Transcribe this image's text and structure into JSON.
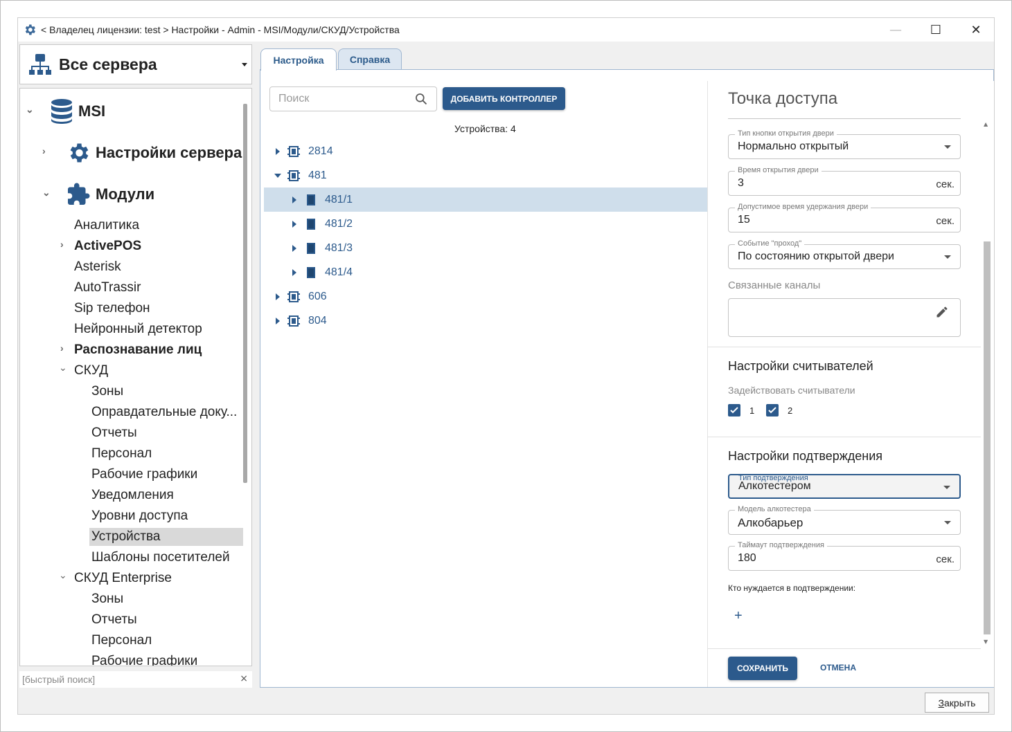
{
  "window": {
    "title": "< Владелец лицензии: test > Настройки - Admin - MSI/Модули/СКУД/Устройства",
    "min_symbol": "—",
    "max_symbol": "☐",
    "close_symbol": "✕"
  },
  "server_select": {
    "label": "Все сервера"
  },
  "tree": {
    "root": "MSI",
    "server_settings": "Настройки сервера",
    "modules": "Модули",
    "items": [
      {
        "label": "Аналитика"
      },
      {
        "label": "ActivePOS"
      },
      {
        "label": "Asterisk"
      },
      {
        "label": "AutoTrassir"
      },
      {
        "label": "Sip телефон"
      },
      {
        "label": "Нейронный детектор"
      },
      {
        "label": "Распознавание лиц"
      },
      {
        "label": "СКУД"
      },
      {
        "label": "Зоны"
      },
      {
        "label": "Оправдательные доку..."
      },
      {
        "label": "Отчеты"
      },
      {
        "label": "Персонал"
      },
      {
        "label": "Рабочие графики"
      },
      {
        "label": "Уведомления"
      },
      {
        "label": "Уровни доступа"
      },
      {
        "label": "Устройства"
      },
      {
        "label": "Шаблоны посетителей"
      },
      {
        "label": "СКУД Enterprise"
      },
      {
        "label": "Зоны"
      },
      {
        "label": "Отчеты"
      },
      {
        "label": "Персонал"
      },
      {
        "label": "Рабочие графики"
      }
    ],
    "quick_search_placeholder": "[быстрый поиск]",
    "quick_search_clear": "×"
  },
  "tabs": [
    {
      "label": "Настройка"
    },
    {
      "label": "Справка"
    }
  ],
  "devices": {
    "search_placeholder": "Поиск",
    "add_button": "ДОБАВИТЬ КОНТРОЛЛЕР",
    "count_label": "Устройства: 4",
    "rows": [
      {
        "label": "2814"
      },
      {
        "label": "481"
      },
      {
        "label": "481/1"
      },
      {
        "label": "481/2"
      },
      {
        "label": "481/3"
      },
      {
        "label": "481/4"
      },
      {
        "label": "606"
      },
      {
        "label": "804"
      }
    ]
  },
  "access_point": {
    "title": "Точка доступа",
    "door_button_type": {
      "label": "Тип кнопки открытия двери",
      "value": "Нормально открытый"
    },
    "door_open_time": {
      "label": "Время открытия двери",
      "value": "3",
      "unit": "сек."
    },
    "door_hold_time": {
      "label": "Допустимое время удержания двери",
      "value": "15",
      "unit": "сек."
    },
    "pass_event": {
      "label": "Событие \"проход\"",
      "value": "По состоянию открытой двери"
    },
    "linked_channels_label": "Связанные каналы",
    "readers": {
      "title": "Настройки считывателей",
      "use_label": "Задействовать считыватели",
      "options": [
        {
          "label": "1"
        },
        {
          "label": "2"
        }
      ]
    },
    "confirmation": {
      "title": "Настройки подтверждения",
      "type": {
        "label": "Тип подтверждения",
        "value": "Алкотестером"
      },
      "model": {
        "label": "Модель алкотестера",
        "value": "Алкобарьер"
      },
      "timeout": {
        "label": "Таймаут подтверждения",
        "value": "180",
        "unit": "сек."
      },
      "who_label": "Кто нуждается в подтверждении:",
      "add_symbol": "+"
    },
    "save_button": "СОХРАНИТЬ",
    "cancel_button": "ОТМЕНА"
  },
  "footer": {
    "close_button_accel": "З",
    "close_button_rest": "акрыть"
  },
  "colors": {
    "accent": "#2c5a8c",
    "selected_row": "#cfdeeb",
    "tree_selected": "#d9d9d9"
  }
}
